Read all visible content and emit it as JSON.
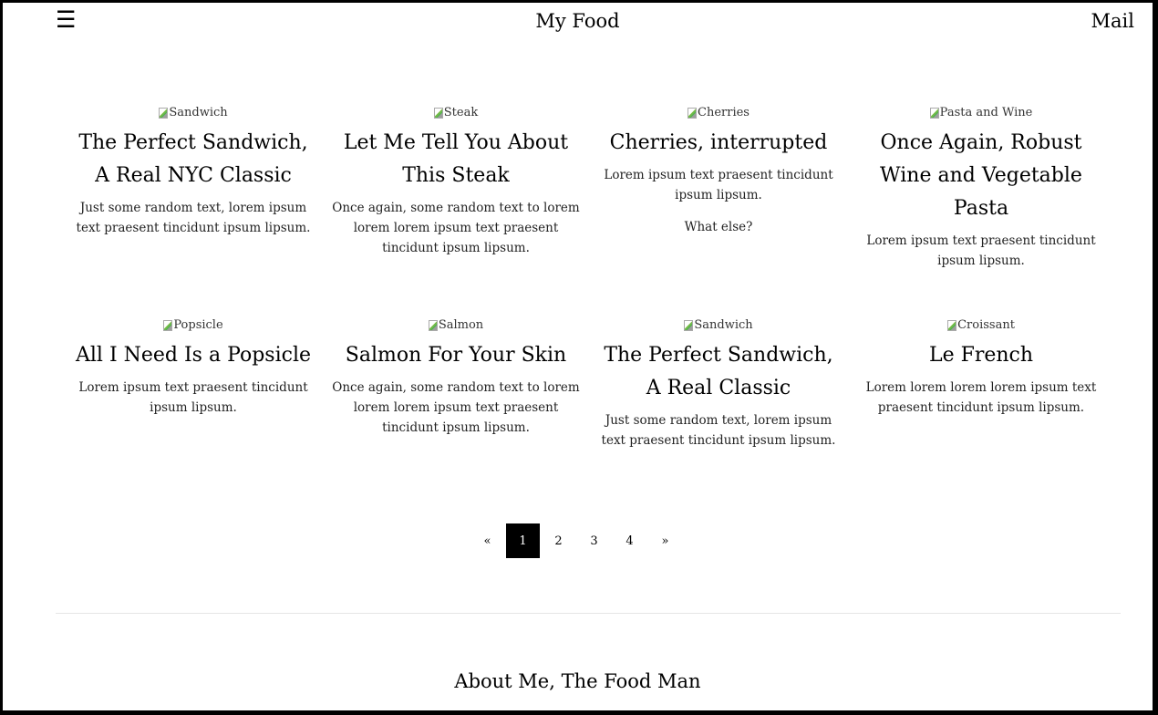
{
  "header": {
    "menu_icon": "☰",
    "site_title": "My Food",
    "mail_label": "Mail"
  },
  "cards": [
    {
      "image_alt": "Sandwich",
      "title": "The Perfect Sandwich, A Real NYC Classic",
      "text": "Just some random text, lorem ipsum text praesent tincidunt ipsum lipsum.",
      "text2": ""
    },
    {
      "image_alt": "Steak",
      "title": "Let Me Tell You About This Steak",
      "text": "Once again, some random text to lorem lorem lorem ipsum text praesent tincidunt ipsum lipsum.",
      "text2": ""
    },
    {
      "image_alt": "Cherries",
      "title": "Cherries, interrupted",
      "text": "Lorem ipsum text praesent tincidunt ipsum lipsum.",
      "text2": "What else?"
    },
    {
      "image_alt": "Pasta and Wine",
      "title": "Once Again, Robust Wine and Vegetable Pasta",
      "text": "Lorem ipsum text praesent tincidunt ipsum lipsum.",
      "text2": ""
    },
    {
      "image_alt": "Popsicle",
      "title": "All I Need Is a Popsicle",
      "text": "Lorem ipsum text praesent tincidunt ipsum lipsum.",
      "text2": ""
    },
    {
      "image_alt": "Salmon",
      "title": "Salmon For Your Skin",
      "text": "Once again, some random text to lorem lorem lorem ipsum text praesent tincidunt ipsum lipsum.",
      "text2": ""
    },
    {
      "image_alt": "Sandwich",
      "title": "The Perfect Sandwich, A Real Classic",
      "text": "Just some random text, lorem ipsum text praesent tincidunt ipsum lipsum.",
      "text2": ""
    },
    {
      "image_alt": "Croissant",
      "title": "Le French",
      "text": "Lorem lorem lorem lorem ipsum text praesent tincidunt ipsum lipsum.",
      "text2": ""
    }
  ],
  "pagination": {
    "prev": "«",
    "pages": [
      "1",
      "2",
      "3",
      "4"
    ],
    "active": "1",
    "next": "»"
  },
  "about": {
    "title": "About Me, The Food Man"
  }
}
